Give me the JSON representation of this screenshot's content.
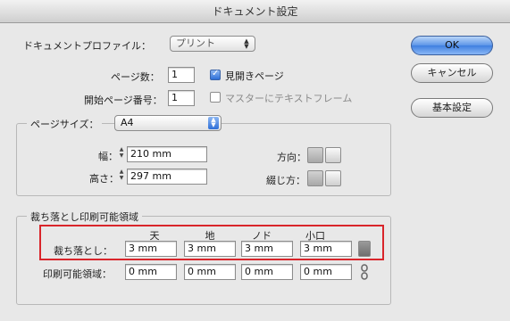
{
  "window": {
    "title": "ドキュメント設定"
  },
  "profile": {
    "label": "ドキュメントプロファイル：",
    "value": "プリント"
  },
  "pages": {
    "count_label": "ページ数：",
    "count_value": "1",
    "facing_label": "見開きページ",
    "facing_checked": true,
    "start_label": "開始ページ番号：",
    "start_value": "1",
    "master_label": "マスターにテキストフレーム",
    "master_checked": false
  },
  "page_size": {
    "label": "ページサイズ：",
    "value": "A4",
    "width_label": "幅：",
    "width_value": "210 mm",
    "height_label": "高さ：",
    "height_value": "297 mm",
    "orientation_label": "方向：",
    "binding_label": "綴じ方："
  },
  "bleed": {
    "legend": "裁ち落とし印刷可能領域",
    "columns": [
      "天",
      "地",
      "ノド",
      "小口"
    ],
    "bleed_label": "裁ち落とし：",
    "bleed_values": [
      "3 mm",
      "3 mm",
      "3 mm",
      "3 mm"
    ],
    "slug_label": "印刷可能領域：",
    "slug_values": [
      "0 mm",
      "0 mm",
      "0 mm",
      "0 mm"
    ]
  },
  "buttons": {
    "ok": "OK",
    "cancel": "キャンセル",
    "basic": "基本設定"
  },
  "colors": {
    "highlight": "#d9252b",
    "accent": "#3f7fe0"
  }
}
